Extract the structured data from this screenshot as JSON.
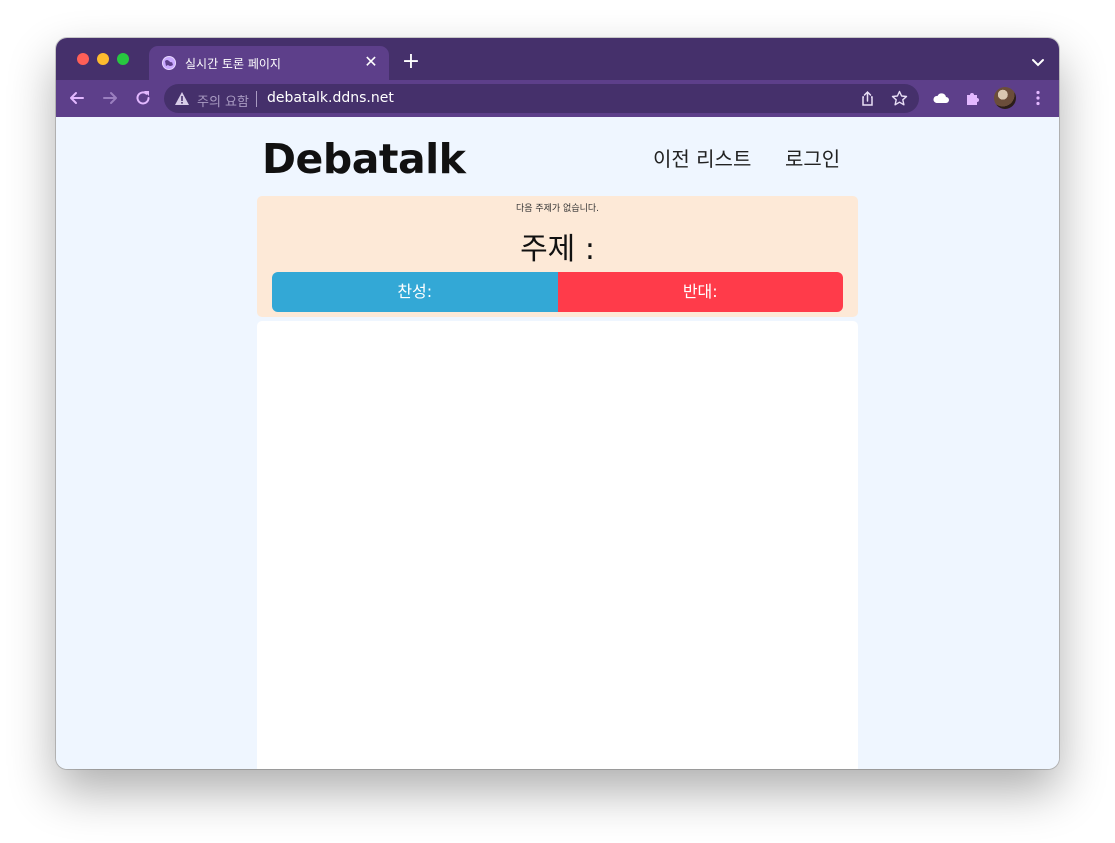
{
  "browser": {
    "tab": {
      "title": "실시간 토론 페이지",
      "close_glyph": "✕"
    },
    "new_tab_glyph": "+",
    "address_bar": {
      "security_label": "주의 요함",
      "url": "debatalk.ddns.net"
    },
    "colors": {
      "frame": "#45306b",
      "toolbar": "#5d3f8a"
    }
  },
  "site": {
    "logo": "Debatalk",
    "nav": {
      "prev_list": "이전 리스트",
      "login": "로그인"
    },
    "topic": {
      "next_topic_notice": "다음 주제가 없습니다.",
      "title": "주제 :",
      "agree_label": "찬성:",
      "disagree_label": "반대:",
      "agree_color": "#33a8d6",
      "disagree_color": "#ff3b4a"
    }
  },
  "icons": {
    "back": "arrow-left-icon",
    "forward": "arrow-right-icon",
    "reload": "reload-icon",
    "warning": "warning-icon",
    "share": "share-icon",
    "bookmark": "star-icon",
    "cloud": "cloud-icon",
    "extensions": "puzzle-icon",
    "menu": "kebab-menu-icon",
    "tab_list": "chevron-down-icon"
  }
}
